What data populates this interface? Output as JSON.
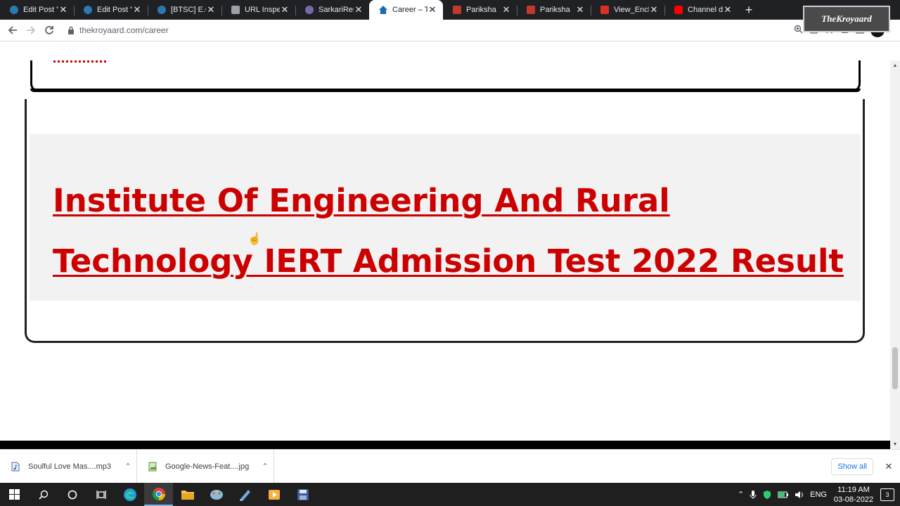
{
  "browser": {
    "tabs": [
      {
        "label": "Edit Post \"Je",
        "favicon_color": "#2a7ab0",
        "active": false
      },
      {
        "label": "Edit Post \"[I",
        "favicon_color": "#2a7ab0",
        "active": false
      },
      {
        "label": "[BTSC] E.C.C",
        "favicon_color": "#2a7ab0",
        "active": false
      },
      {
        "label": "URL Inspecti",
        "favicon_color": "#9aa0a6",
        "active": false
      },
      {
        "label": "SarkariResu",
        "favicon_color": "#7b68a6",
        "active": false
      },
      {
        "label": "Career – Th",
        "favicon_color": "#1b6ea8",
        "active": true
      },
      {
        "label": "Pariksha",
        "favicon_color": "#c0392b",
        "active": false
      },
      {
        "label": "Pariksha",
        "favicon_color": "#c0392b",
        "active": false
      },
      {
        "label": "View_Enclo",
        "favicon_color": "#d93025",
        "active": false
      },
      {
        "label": "Channel da",
        "favicon_color": "#ff0000",
        "active": false
      }
    ],
    "tab_close": "✕",
    "new_tab": "+",
    "url": "thekroyaard.com/career",
    "watermark": "TheKroyaard"
  },
  "page": {
    "result_link_line1": "Institute Of Engineering And Rural",
    "result_link_line2": "Technology IERT Admission Test 2022 Result"
  },
  "downloads": {
    "items": [
      {
        "name": "Soulful Love Mas....mp3"
      },
      {
        "name": "Google-News-Feat....jpg"
      }
    ],
    "show_all": "Show all"
  },
  "taskbar": {
    "language": "ENG",
    "time": "11:19 AM",
    "date": "03-08-2022",
    "notifications": "3"
  }
}
